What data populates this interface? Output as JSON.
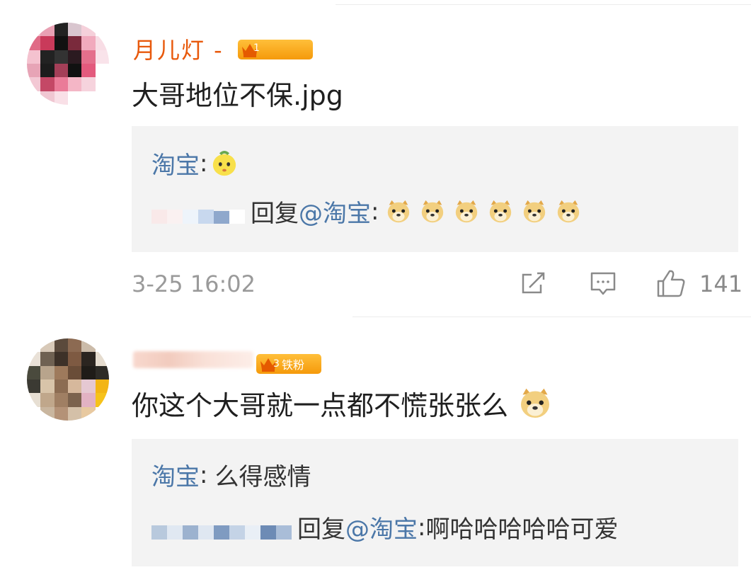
{
  "comments": [
    {
      "username": "月儿灯 -",
      "badge": "1",
      "text": "大哥地位不保.jpg",
      "replies": [
        {
          "author": "淘宝",
          "sep": ":",
          "text": "",
          "emoji": "melon-face-icon"
        },
        {
          "reply_word": "回复",
          "mention": "@淘宝",
          "sep": ":",
          "text": "",
          "emoji_count": 6,
          "emoji": "doge-icon"
        }
      ],
      "time": "3-25 16:02",
      "likes": "141"
    },
    {
      "username": "云端遥梦",
      "badge": "铁粉",
      "badge_level": "3",
      "text": "你这个大哥就一点都不慌张张么",
      "replies": [
        {
          "author": "淘宝",
          "sep": ":",
          "text": "么得感情"
        },
        {
          "reply_word": "回复",
          "mention": "@淘宝",
          "sep": ":",
          "text": "啊哈哈哈哈哈可爱"
        }
      ]
    }
  ],
  "colors": {
    "username": "#e8590c",
    "link": "#4b77a8",
    "reply_bg": "#f3f3f3",
    "badge": "#f7a21b"
  }
}
